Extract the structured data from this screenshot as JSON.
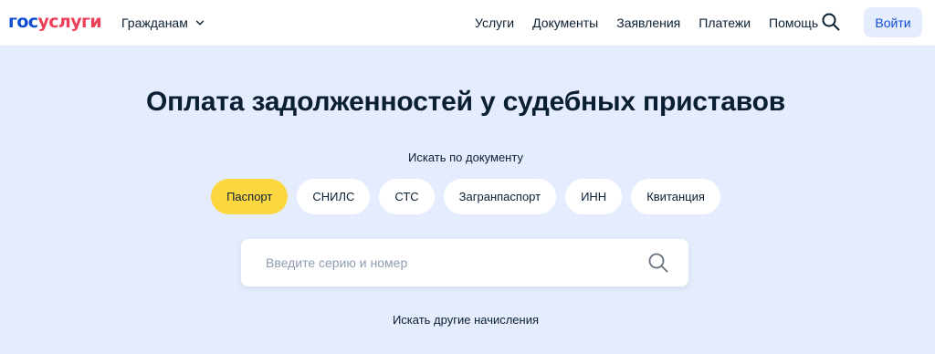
{
  "header": {
    "logo": {
      "part1": "гос",
      "part2": "услуги"
    },
    "citizens_label": "Гражданам",
    "nav": [
      "Услуги",
      "Документы",
      "Заявления",
      "Платежи",
      "Помощь"
    ],
    "search_icon": "search-icon",
    "login_label": "Войти"
  },
  "main": {
    "title": "Оплата задолженностей у судебных приставов",
    "subtitle": "Искать по документу",
    "chips": [
      "Паспорт",
      "СНИЛС",
      "СТС",
      "Загранпаспорт",
      "ИНН",
      "Квитанция"
    ],
    "active_chip": "Паспорт",
    "search": {
      "placeholder": "Введите серию и номер",
      "value": ""
    },
    "other_link": "Искать другие начисления"
  },
  "colors": {
    "brand_blue": "#0d4cd3",
    "brand_red": "#ee3f58",
    "page_bg": "#e4ecfd",
    "chip_active": "#fcd740",
    "text": "#0b1f33"
  }
}
